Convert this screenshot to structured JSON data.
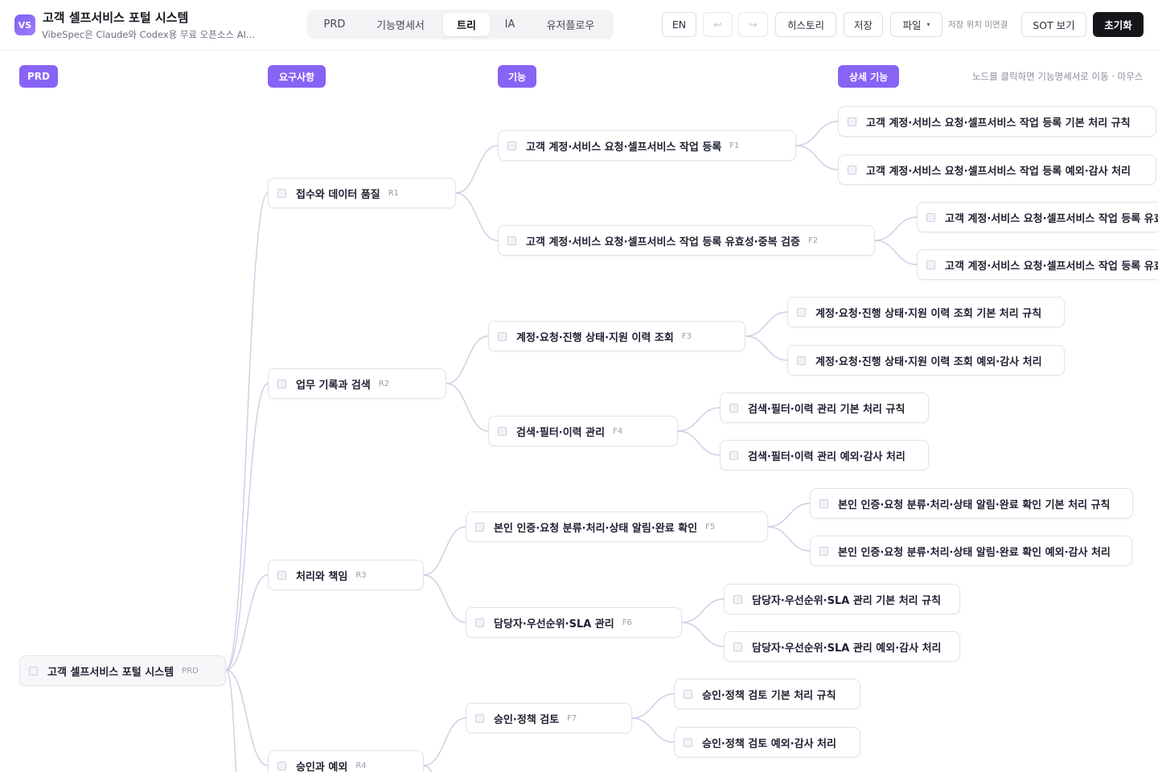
{
  "app": {
    "logo": "VS",
    "title": "고객 셀프서비스 포털 시스템",
    "subtitle": "VibeSpec은 Claude와 Codex용 무료 오픈소스 AI..."
  },
  "tabs": [
    {
      "label": "PRD",
      "active": false
    },
    {
      "label": "기능명세서",
      "active": false
    },
    {
      "label": "트리",
      "active": true
    },
    {
      "label": "IA",
      "active": false
    },
    {
      "label": "유저플로우",
      "active": false
    }
  ],
  "toolbar": {
    "lang": "EN",
    "undo_icon": "undo-icon",
    "redo_icon": "redo-icon",
    "undo_glyph": "↩",
    "redo_glyph": "↪",
    "history": "히스토리",
    "save": "저장",
    "file": "파일",
    "file_chevron": "▾",
    "save_location": "저장 위치 미연결",
    "sot": "SOT 보기",
    "reset": "초기화"
  },
  "canvas": {
    "hint": "노드를 클릭하면 기능명세서로 이동 · 마우스",
    "columns": [
      "PRD",
      "요구사항",
      "기능",
      "상세 기능"
    ]
  },
  "colors": {
    "accent": "#8763f6",
    "edge": "#cfcbe6",
    "node_border": "#e2e3ea"
  },
  "tree": {
    "root": {
      "label": "고객 셀프서비스 포털 시스템",
      "id": "PRD"
    },
    "requirements": [
      {
        "label": "접수와 데이터 품질",
        "id": "R1"
      },
      {
        "label": "업무 기록과 검색",
        "id": "R2"
      },
      {
        "label": "처리와 책임",
        "id": "R3"
      },
      {
        "label": "승인과 예외",
        "id": "R4"
      }
    ],
    "features": [
      {
        "label": "고객 계정·서비스 요청·셀프서비스 작업 등록",
        "id": "F1"
      },
      {
        "label": "고객 계정·서비스 요청·셀프서비스 작업 등록 유효성·중복 검증",
        "id": "F2"
      },
      {
        "label": "계정·요청·진행 상태·지원 이력 조회",
        "id": "F3"
      },
      {
        "label": "검색·필터·이력 관리",
        "id": "F4"
      },
      {
        "label": "본인 인증·요청 분류·처리·상태 알림·완료 확인",
        "id": "F5"
      },
      {
        "label": "담당자·우선순위·SLA 관리",
        "id": "F6"
      },
      {
        "label": "승인·정책 검토",
        "id": "F7"
      }
    ],
    "details": [
      {
        "label": "고객 계정·서비스 요청·셀프서비스 작업 등록 기본 처리 규칙"
      },
      {
        "label": "고객 계정·서비스 요청·셀프서비스 작업 등록 예외·감사 처리"
      },
      {
        "label": "고객 계정·서비스 요청·셀프서비스 작업 등록 유효"
      },
      {
        "label": "고객 계정·서비스 요청·셀프서비스 작업 등록 유효"
      },
      {
        "label": "계정·요청·진행 상태·지원 이력 조회 기본 처리 규칙"
      },
      {
        "label": "계정·요청·진행 상태·지원 이력 조회 예외·감사 처리"
      },
      {
        "label": "검색·필터·이력 관리 기본 처리 규칙"
      },
      {
        "label": "검색·필터·이력 관리 예외·감사 처리"
      },
      {
        "label": "본인 인증·요청 분류·처리·상태 알림·완료 확인 기본 처리 규칙"
      },
      {
        "label": "본인 인증·요청 분류·처리·상태 알림·완료 확인 예외·감사 처리"
      },
      {
        "label": "담당자·우선순위·SLA 관리 기본 처리 규칙"
      },
      {
        "label": "담당자·우선순위·SLA 관리 예외·감사 처리"
      },
      {
        "label": "승인·정책 검토 기본 처리 규칙"
      },
      {
        "label": "승인·정책 검토 예외·감사 처리"
      }
    ]
  }
}
